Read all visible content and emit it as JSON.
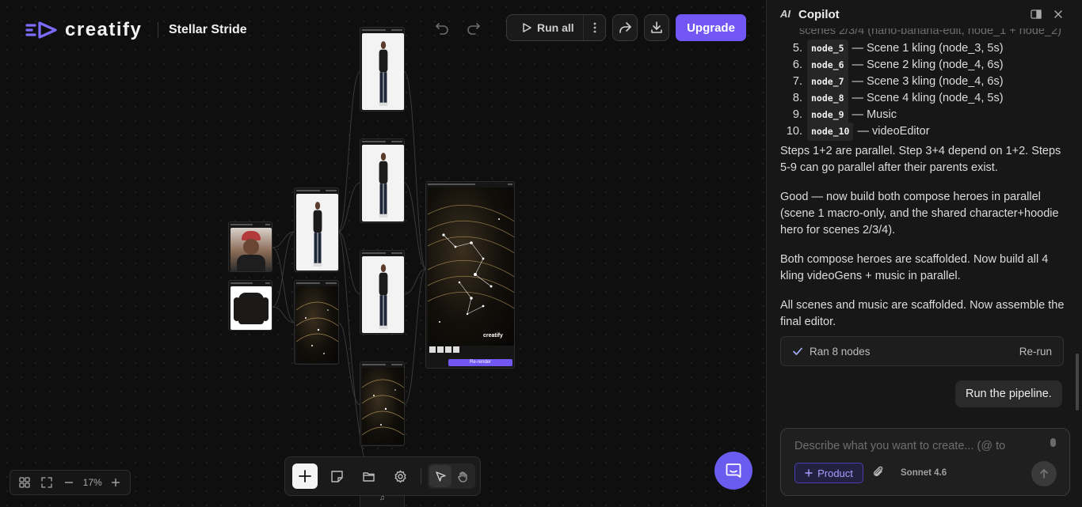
{
  "header": {
    "brand": "creatify",
    "project_name": "Stellar Stride",
    "run_all_label": "Run all",
    "upgrade_label": "Upgrade"
  },
  "icons": {
    "undo": "undo-icon",
    "redo": "redo-icon",
    "more": "more-vertical-icon",
    "share": "share-icon",
    "download": "download-icon"
  },
  "zoom": {
    "level": "17%"
  },
  "node_labels": {
    "final_editor_button": "Re-render",
    "final_editor_logo": "creatify"
  },
  "copilot": {
    "title": "Copilot",
    "logo": "AI",
    "cut_line": "scenes 2/3/4 (nano-banana-edit, node_1 + node_2)",
    "steps": [
      {
        "num": "5.",
        "code": "node_5",
        "text": "— Scene 1 kling (node_3, 5s)"
      },
      {
        "num": "6.",
        "code": "node_6",
        "text": "— Scene 2 kling (node_4, 6s)"
      },
      {
        "num": "7.",
        "code": "node_7",
        "text": "— Scene 3 kling (node_4, 6s)"
      },
      {
        "num": "8.",
        "code": "node_8",
        "text": "— Scene 4 kling (node_4, 5s)"
      },
      {
        "num": "9.",
        "code": "node_9",
        "text": "— Music"
      },
      {
        "num": "10.",
        "code": "node_10",
        "text": "— videoEditor"
      }
    ],
    "paragraphs": [
      "Steps 1+2 are parallel. Step 3+4 depend on 1+2. Steps 5-9 can go parallel after their parents exist.",
      "Good — now build both compose heroes in parallel (scene 1 macro-only, and the shared character+hoodie hero for scenes 2/3/4).",
      "Both compose heroes are scaffolded. Now build all 4 kling videoGens + music in parallel.",
      "All scenes and music are scaffolded. Now assemble the final editor."
    ],
    "ran_label": "Ran 8 nodes",
    "rerun_label": "Re-run",
    "user_message": "Run the pipeline.",
    "composer_placeholder": "Describe what you want to create... (@ to",
    "product_chip": "Product",
    "model": "Sonnet 4.6"
  },
  "colors": {
    "accent": "#7257f5",
    "help_bubble": "#6b5cf0"
  }
}
